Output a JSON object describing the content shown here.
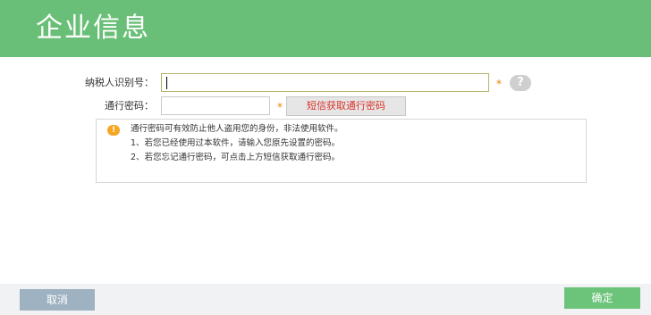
{
  "header": {
    "title": "企业信息"
  },
  "form": {
    "tax_id": {
      "label": "纳税人识别号：",
      "value": "",
      "required_mark": "*",
      "help_icon": "?"
    },
    "password": {
      "label": "通行密码：",
      "value": "",
      "required_mark": "*"
    },
    "sms_button": "短信获取通行密码"
  },
  "notice": {
    "icon": "!",
    "lines": [
      "通行密码可有效防止他人盗用您的身份，非法使用软件。",
      "1、若您已经使用过本软件，请输入您原先设置的密码。",
      "2、若您忘记通行密码，可点击上方短信获取通行密码。"
    ]
  },
  "footer": {
    "cancel": "取消",
    "confirm": "确定"
  },
  "colors": {
    "header_bg": "#69bf77",
    "confirm_bg": "#6cc47a",
    "cancel_bg": "#9fb2c1",
    "required": "#f08300",
    "sms_text": "#d9322a",
    "warning": "#f5a623"
  }
}
